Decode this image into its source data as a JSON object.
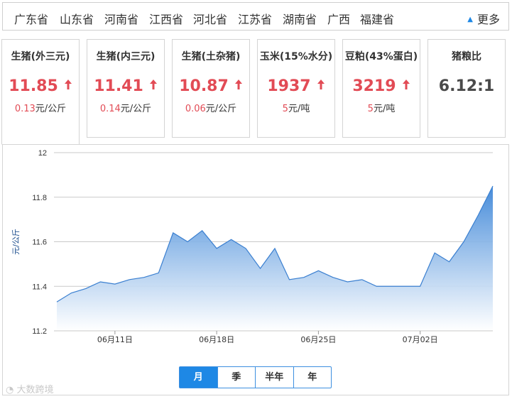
{
  "provinces": [
    "广东省",
    "山东省",
    "河南省",
    "江西省",
    "河北省",
    "江苏省",
    "湖南省",
    "广西",
    "福建省"
  ],
  "more_label": "更多",
  "cards": [
    {
      "title": "生猪(外三元)",
      "price": "11.85",
      "change": "0.13",
      "unit": "元/公斤",
      "trend": "up"
    },
    {
      "title": "生猪(内三元)",
      "price": "11.41",
      "change": "0.14",
      "unit": "元/公斤",
      "trend": "up"
    },
    {
      "title": "生猪(土杂猪)",
      "price": "10.87",
      "change": "0.06",
      "unit": "元/公斤",
      "trend": "up"
    },
    {
      "title": "玉米(15%水分)",
      "price": "1937",
      "change": "5",
      "unit": "元/吨",
      "trend": "up"
    },
    {
      "title": "豆粕(43%蛋白)",
      "price": "3219",
      "change": "5",
      "unit": "元/吨",
      "trend": "up"
    },
    {
      "title": "猪粮比",
      "price": "6.12:1"
    }
  ],
  "range_tabs": [
    {
      "label": "月",
      "selected": true
    },
    {
      "label": "季",
      "selected": false
    },
    {
      "label": "半年",
      "selected": false
    },
    {
      "label": "年",
      "selected": false
    }
  ],
  "watermark": "大数跨境",
  "colors": {
    "up": "#e24b55",
    "accent": "#1e88e5",
    "line": "#3a7fd0"
  },
  "chart_data": {
    "type": "area",
    "ylabel": "元/公斤",
    "ylim": [
      11.2,
      12
    ],
    "yticks": [
      "11.2",
      "11.4",
      "11.6",
      "11.8",
      "12"
    ],
    "xticks": [
      "06月11日",
      "06月18日",
      "06月25日",
      "07月02日"
    ],
    "xtick_positions": [
      4,
      11,
      18,
      25
    ],
    "grid": true,
    "series": [
      {
        "values": [
          11.33,
          11.37,
          11.39,
          11.42,
          11.41,
          11.43,
          11.44,
          11.46,
          11.64,
          11.6,
          11.65,
          11.57,
          11.61,
          11.57,
          11.48,
          11.57,
          11.43,
          11.44,
          11.47,
          11.44,
          11.42,
          11.43,
          11.4,
          11.4,
          11.4,
          11.4,
          11.55,
          11.51,
          11.6,
          11.72,
          11.85
        ]
      }
    ]
  }
}
